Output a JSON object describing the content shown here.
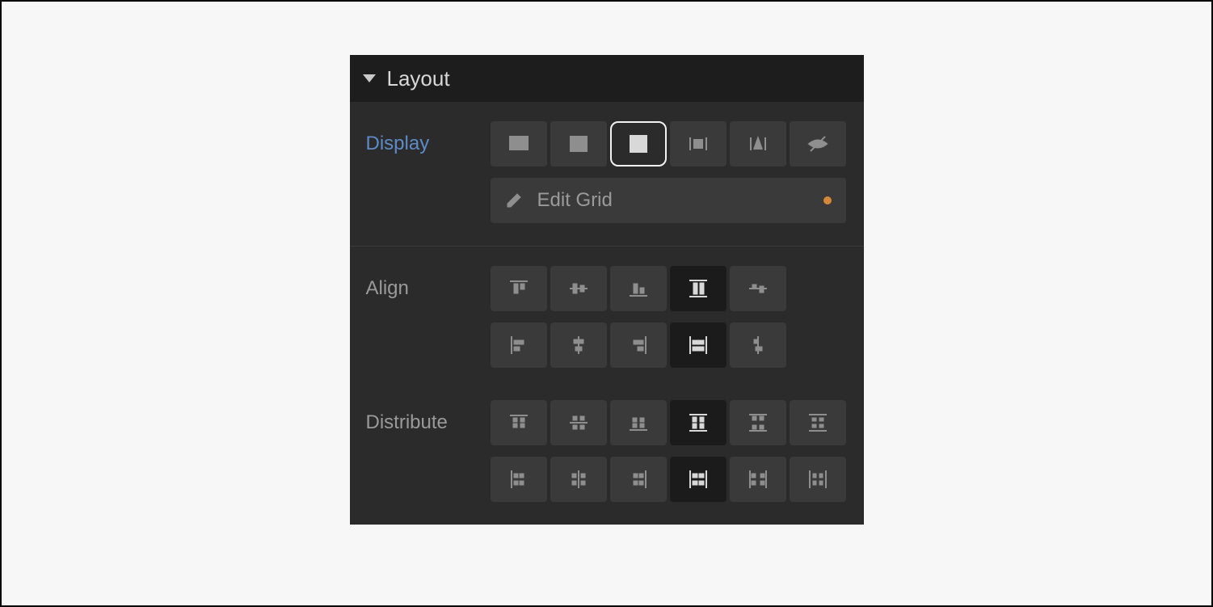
{
  "panel": {
    "title": "Layout",
    "sections": {
      "display": {
        "label": "Display",
        "options": [
          "block",
          "flex",
          "grid",
          "inline-block",
          "inline",
          "none"
        ],
        "selected": "grid",
        "edit_button": {
          "label": "Edit Grid",
          "indicator": "modified"
        }
      },
      "align": {
        "label": "Align",
        "row1": {
          "options": [
            "start",
            "center",
            "end",
            "stretch",
            "baseline"
          ],
          "selected": "stretch"
        },
        "row2": {
          "options": [
            "start",
            "center",
            "end",
            "stretch",
            "baseline"
          ],
          "selected": "stretch"
        }
      },
      "distribute": {
        "label": "Distribute",
        "row1": {
          "options": [
            "start",
            "center",
            "end",
            "stretch",
            "space-between",
            "space-around"
          ],
          "selected": "stretch"
        },
        "row2": {
          "options": [
            "start",
            "center",
            "end",
            "stretch",
            "space-between",
            "space-around"
          ],
          "selected": "stretch"
        }
      }
    }
  }
}
